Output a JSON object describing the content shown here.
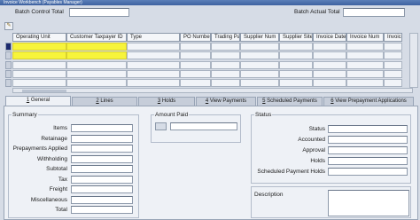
{
  "window": {
    "title": "Invoice Workbench (Payables Manager)"
  },
  "batch": {
    "control_total_label": "Batch Control Total",
    "actual_total_label": "Batch Actual Total"
  },
  "grid": {
    "columns": [
      "Operating Unit",
      "Customer Taxpayer ID",
      "Type",
      "PO Number",
      "Trading Pa",
      "Supplier Num",
      "Supplier Site",
      "Invoice Date",
      "Invoice Num",
      "Invoice"
    ]
  },
  "tabs": [
    {
      "num": "1",
      "label": " General"
    },
    {
      "num": "2",
      "label": " Lines"
    },
    {
      "num": "3",
      "label": " Holds"
    },
    {
      "num": "4",
      "label": " View Payments"
    },
    {
      "num": "5",
      "label": " Scheduled Payments"
    },
    {
      "num": "6",
      "label": " View Prepayment Applications"
    }
  ],
  "summary": {
    "title": "Summary",
    "rows": [
      "Items",
      "Retainage",
      "Prepayments Applied",
      "Withholding",
      "Subtotal",
      "Tax",
      "Freight",
      "Miscellaneous",
      "Total"
    ]
  },
  "amount_paid": {
    "title": "Amount Paid"
  },
  "status": {
    "title": "Status",
    "rows": [
      "Status",
      "Accounted",
      "Approval",
      "Holds",
      "Scheduled Payment Holds"
    ]
  },
  "description": {
    "label": "Description"
  },
  "colors": {
    "highlight": "#f7f43a",
    "title_bar": "#3e62a0"
  }
}
